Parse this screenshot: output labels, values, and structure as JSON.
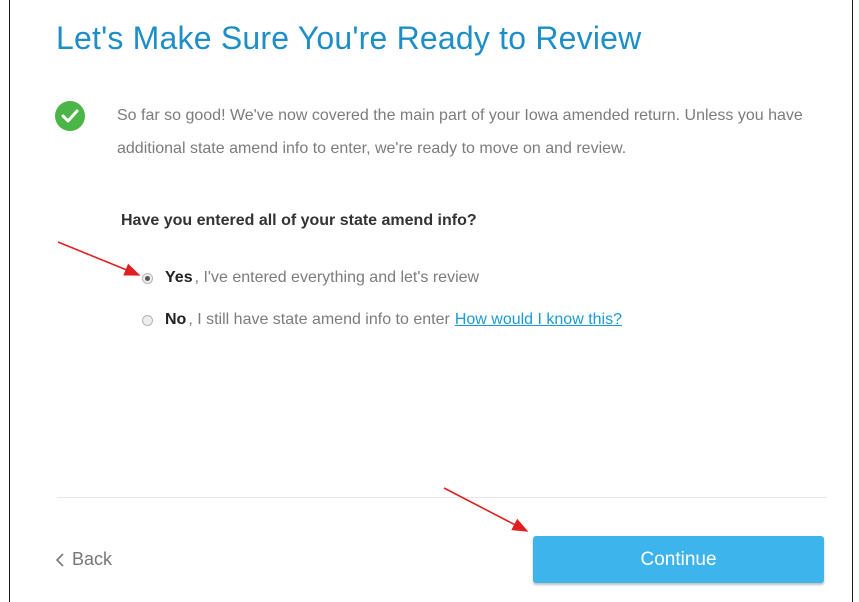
{
  "header": {
    "title": "Let's Make Sure You're Ready to Review"
  },
  "status": {
    "icon": "check-circle-icon",
    "color": "#4cb547",
    "message": "So far so good! We've now covered the main part of your Iowa amended return. Unless you have additional state amend info to enter, we're ready to move on and review."
  },
  "question": {
    "text": "Have you entered all of your state amend info?",
    "options": [
      {
        "label": "Yes",
        "description": ", I've entered everything and let's review",
        "selected": true
      },
      {
        "label": "No",
        "description": ", I still have state amend info to enter",
        "selected": false
      }
    ],
    "help_link": "How would I know this?"
  },
  "footer": {
    "back_label": "Back",
    "back_icon": "chevron-left-icon",
    "continue_label": "Continue",
    "continue_color": "#3db4ec"
  },
  "annotations": {
    "arrow_color": "#e02020"
  }
}
